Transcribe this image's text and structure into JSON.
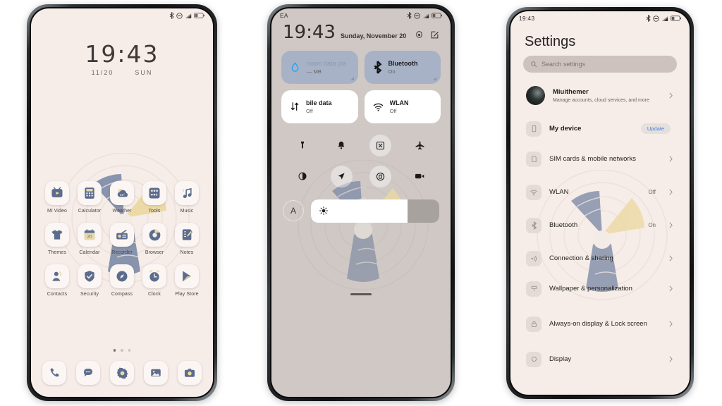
{
  "phone1": {
    "statusbar": {
      "left": "",
      "icons": [
        "bluetooth-icon",
        "dnd-icon",
        "signal-icon",
        "battery-icon"
      ]
    },
    "clock": {
      "time": "19:43",
      "date": "11/20",
      "weekday": "SUN"
    },
    "apps": [
      [
        {
          "label": "Mi Video",
          "icon": "mi-video-icon"
        },
        {
          "label": "Calculator",
          "icon": "calculator-icon"
        },
        {
          "label": "Weather",
          "icon": "weather-icon"
        },
        {
          "label": "Tools",
          "icon": "tools-icon"
        },
        {
          "label": "Music",
          "icon": "music-icon"
        }
      ],
      [
        {
          "label": "Themes",
          "icon": "themes-icon"
        },
        {
          "label": "Calendar",
          "icon": "calendar-icon"
        },
        {
          "label": "Recorder",
          "icon": "recorder-icon"
        },
        {
          "label": "Browser",
          "icon": "browser-icon"
        },
        {
          "label": "Notes",
          "icon": "notes-icon"
        }
      ],
      [
        {
          "label": "Contacts",
          "icon": "contacts-icon"
        },
        {
          "label": "Security",
          "icon": "security-icon"
        },
        {
          "label": "Compass",
          "icon": "compass-icon"
        },
        {
          "label": "Clock",
          "icon": "clock-icon"
        },
        {
          "label": "Play Store",
          "icon": "play-store-icon"
        }
      ]
    ],
    "pages": {
      "count": 3,
      "active": 0
    },
    "dock": [
      {
        "icon": "phone-icon"
      },
      {
        "icon": "messages-icon"
      },
      {
        "icon": "settings-gear-icon"
      },
      {
        "icon": "gallery-icon"
      },
      {
        "icon": "camera-icon"
      }
    ],
    "calendar_day": "20",
    "weather_temp": "26°"
  },
  "phone2": {
    "statusbar": {
      "left": "EA",
      "icons": [
        "bluetooth-icon",
        "dnd-icon",
        "signal-icon",
        "battery-icon"
      ]
    },
    "header": {
      "time": "19:43",
      "date": "Sunday, November 20",
      "gear": "gear-icon",
      "edit": "edit-icon"
    },
    "tiles": [
      {
        "title": "nown data pla",
        "sub": "— MB",
        "state": "on",
        "icon": "data-drop-icon",
        "muted": true
      },
      {
        "title": "Bluetooth",
        "sub": "On",
        "state": "on",
        "icon": "bluetooth-icon",
        "muted": false
      },
      {
        "title": "bile data",
        "sub": "Off",
        "state": "off",
        "icon": "mobile-data-icon",
        "muted": false
      },
      {
        "title": "WLAN",
        "sub": "Off",
        "state": "off",
        "icon": "wlan-icon",
        "muted": false
      }
    ],
    "toggles": [
      {
        "name": "flashlight-icon",
        "style": "plain"
      },
      {
        "name": "sound-bell-icon",
        "style": "plain"
      },
      {
        "name": "screenshot-icon",
        "style": "filled"
      },
      {
        "name": "airplane-mode-icon",
        "style": "plain"
      },
      {
        "name": "dark-mode-icon",
        "style": "plain"
      },
      {
        "name": "location-icon",
        "style": "filled"
      },
      {
        "name": "auto-rotate-icon",
        "style": "filled"
      },
      {
        "name": "screen-record-icon",
        "style": "plain"
      }
    ],
    "brightness": {
      "auto_label": "A",
      "percent": 75,
      "icon": "brightness-icon"
    }
  },
  "phone3": {
    "statusbar": {
      "left": "19:43",
      "icons": [
        "bluetooth-icon",
        "dnd-icon",
        "signal-icon",
        "battery-icon"
      ]
    },
    "title": "Settings",
    "search": {
      "placeholder": "Search settings",
      "icon": "search-icon"
    },
    "account": {
      "name": "Miuithemer",
      "desc": "Manage accounts, cloud services, and more",
      "avatar": "avatar"
    },
    "device": {
      "name": "My device",
      "badge": "Update",
      "icon": "device-icon"
    },
    "group_network": [
      {
        "name": "SIM cards & mobile networks",
        "value": "",
        "icon": "sim-icon"
      },
      {
        "name": "WLAN",
        "value": "Off",
        "icon": "wlan-icon"
      },
      {
        "name": "Bluetooth",
        "value": "On",
        "icon": "bluetooth-icon"
      },
      {
        "name": "Connection & sharing",
        "value": "",
        "icon": "connection-sharing-icon"
      }
    ],
    "group_display": [
      {
        "name": "Wallpaper & personalization",
        "value": "",
        "icon": "wallpaper-icon"
      },
      {
        "name": "Always-on display & Lock screen",
        "value": "",
        "icon": "lock-icon"
      },
      {
        "name": "Display",
        "value": "",
        "icon": "display-icon"
      }
    ]
  },
  "theme": {
    "screen_bg": "#f6ece8",
    "cc_bg": "#cfc8c4",
    "icon_blue": "#5c6c8e",
    "icon_cream": "#e9d9a8",
    "tile_on": "#a8b2c6",
    "accent_link": "#4b7fd6"
  }
}
